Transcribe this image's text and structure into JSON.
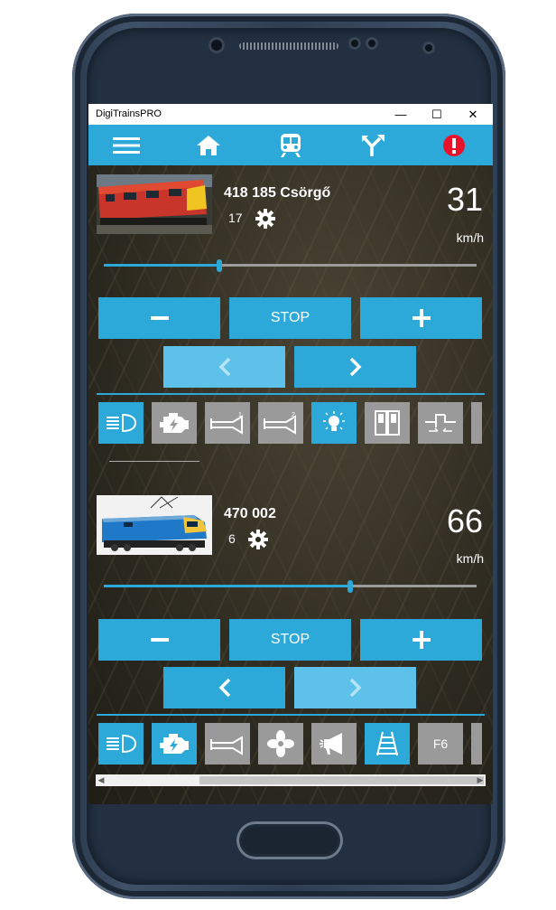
{
  "window": {
    "title": "DigiTrainsPRO",
    "minimize": "—",
    "maximize": "☐",
    "close": "✕"
  },
  "toolbar": {
    "icons": [
      "menu-icon",
      "home-icon",
      "train-icon",
      "turnout-icon",
      "alert-icon"
    ]
  },
  "locos": [
    {
      "name": "418 185 Csörgő",
      "address": "17",
      "speed": "31",
      "unit": "km/h",
      "slider_fraction": 0.31,
      "stop_label": "STOP",
      "direction": "forward",
      "functions": [
        {
          "icon": "headlight-icon",
          "on": true
        },
        {
          "icon": "engine-icon",
          "on": false
        },
        {
          "icon": "horn-1-icon",
          "on": false,
          "badge": "1"
        },
        {
          "icon": "horn-2-icon",
          "on": false,
          "badge": "2"
        },
        {
          "icon": "light-bulb-icon",
          "on": true
        },
        {
          "icon": "doors-icon",
          "on": false
        },
        {
          "icon": "coupler-icon",
          "on": false
        }
      ]
    },
    {
      "name": "470 002",
      "address": "6",
      "speed": "66",
      "unit": "km/h",
      "slider_fraction": 0.66,
      "stop_label": "STOP",
      "direction": "reverse",
      "functions": [
        {
          "icon": "headlight-icon",
          "on": true
        },
        {
          "icon": "engine-icon",
          "on": true
        },
        {
          "icon": "horn-icon",
          "on": false
        },
        {
          "icon": "fan-icon",
          "on": false
        },
        {
          "icon": "announcement-icon",
          "on": false
        },
        {
          "icon": "track-icon",
          "on": true
        },
        {
          "label": "F6",
          "on": false
        }
      ]
    }
  ],
  "colors": {
    "accent": "#2da9d9",
    "inactive": "#9a9a9a",
    "alert": "#e8132a"
  }
}
